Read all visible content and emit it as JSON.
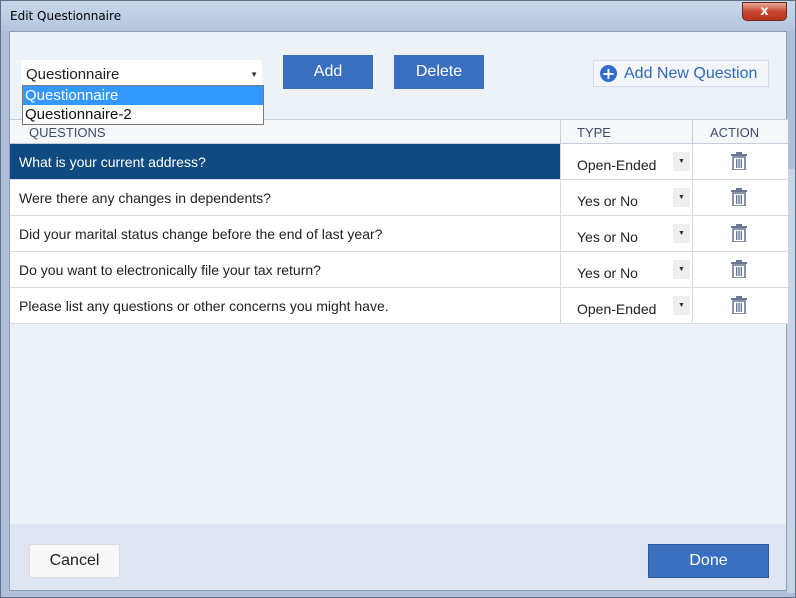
{
  "window": {
    "title": "Edit Questionnaire",
    "close_glyph": "x"
  },
  "questionnaire_select": {
    "value": "Questionnaire",
    "options": [
      "Questionnaire",
      "Questionnaire-2"
    ]
  },
  "toolbar": {
    "add_label": "Add",
    "delete_label": "Delete",
    "add_question_label": "Add New Question"
  },
  "table": {
    "headers": {
      "questions": "QUESTIONS",
      "type": "TYPE",
      "action": "ACTION"
    },
    "rows": [
      {
        "question": "What is your current address?",
        "type": "Open-Ended"
      },
      {
        "question": "Were there any changes in dependents?",
        "type": "Yes or No"
      },
      {
        "question": "Did your marital status change before the end of last year?",
        "type": "Yes or No"
      },
      {
        "question": "Do you want to electronically file your tax return?",
        "type": "Yes or No"
      },
      {
        "question": "Please list any questions or other concerns you might have.",
        "type": "Open-Ended"
      }
    ]
  },
  "footer": {
    "cancel_label": "Cancel",
    "done_label": "Done"
  },
  "colors": {
    "accent": "#3a6fc0",
    "selected_row": "#0f4b80",
    "dropdown_highlight": "#3399ff"
  }
}
